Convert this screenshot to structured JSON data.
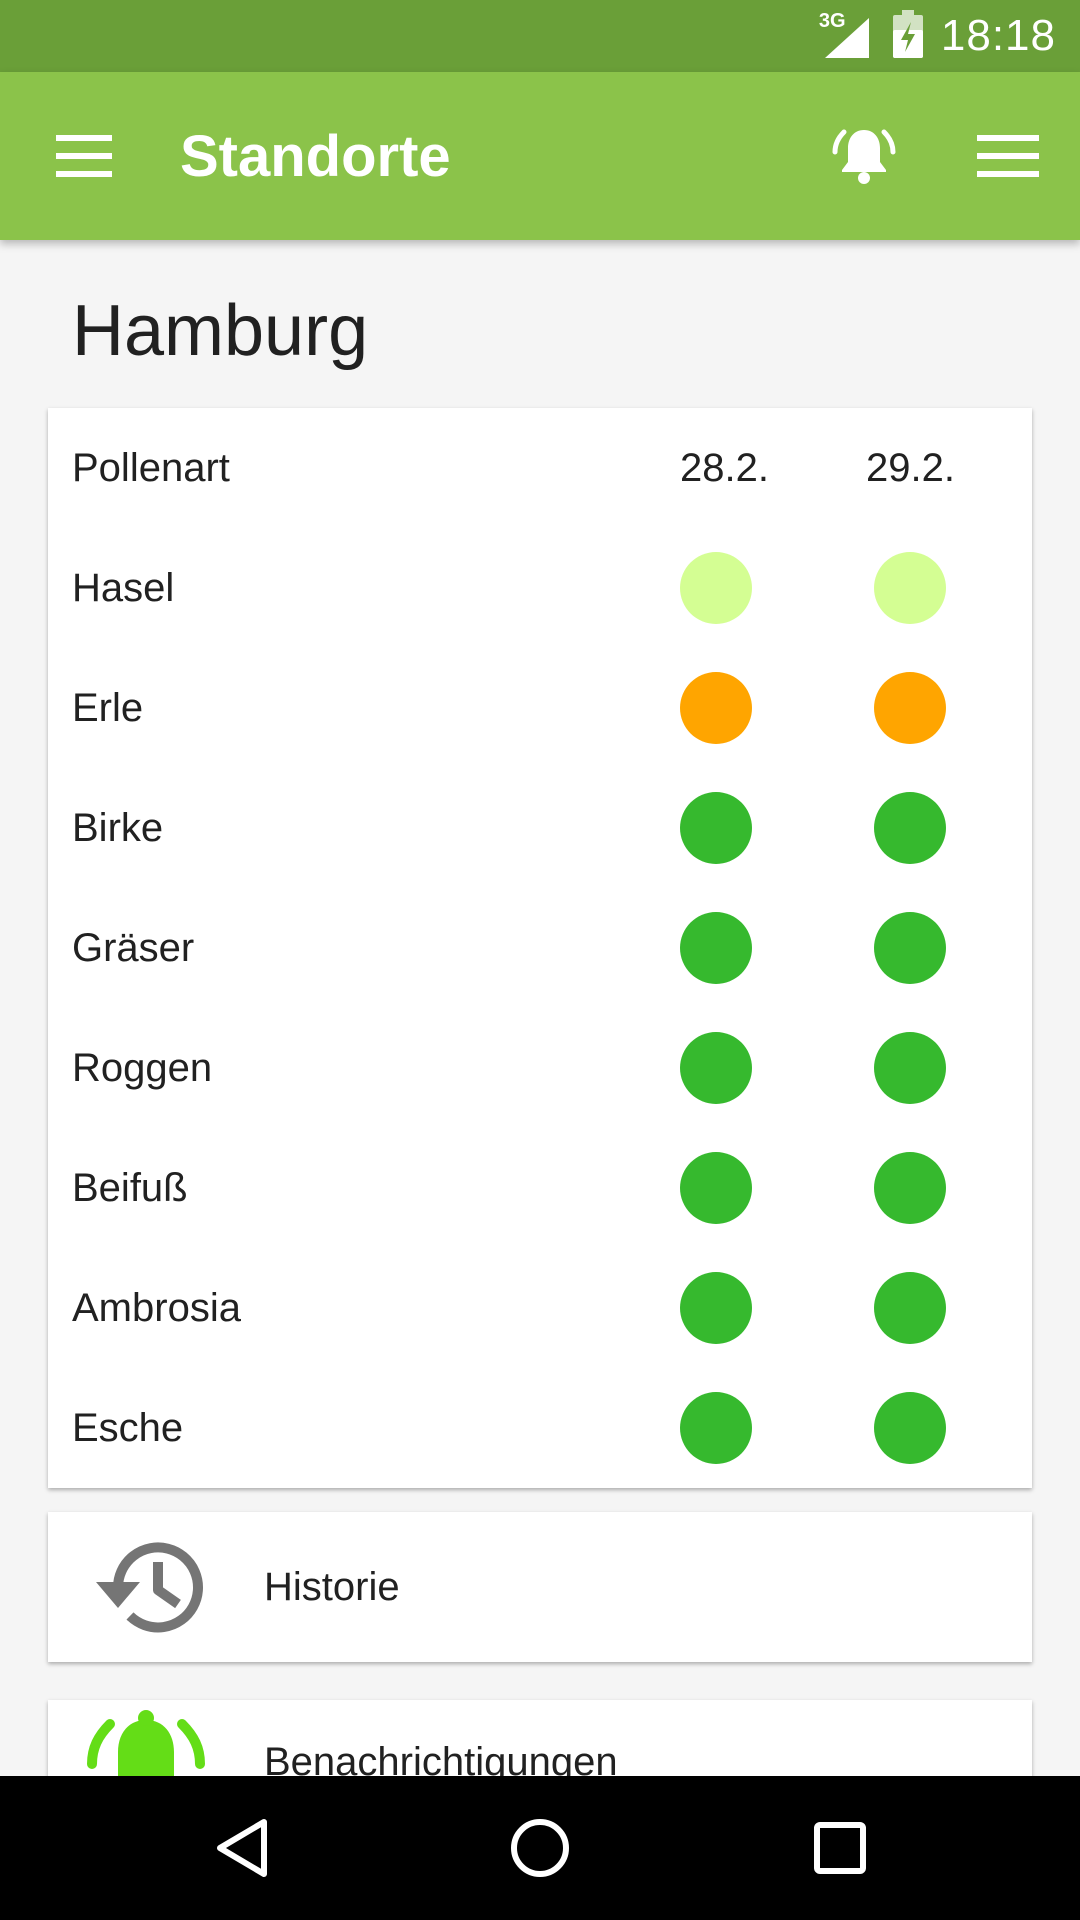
{
  "status_bar": {
    "network": "3G",
    "time": "18:18"
  },
  "app_bar": {
    "title": "Standorte"
  },
  "location": "Hamburg",
  "table": {
    "header": {
      "species": "Pollenart",
      "dates": [
        "28.2.",
        "29.2."
      ]
    },
    "rows": [
      {
        "name": "Hasel",
        "levels": [
          "light",
          "light"
        ]
      },
      {
        "name": "Erle",
        "levels": [
          "medium",
          "medium"
        ]
      },
      {
        "name": "Birke",
        "levels": [
          "none",
          "none"
        ]
      },
      {
        "name": "Gräser",
        "levels": [
          "none",
          "none"
        ]
      },
      {
        "name": "Roggen",
        "levels": [
          "none",
          "none"
        ]
      },
      {
        "name": "Beifuß",
        "levels": [
          "none",
          "none"
        ]
      },
      {
        "name": "Ambrosia",
        "levels": [
          "none",
          "none"
        ]
      },
      {
        "name": "Esche",
        "levels": [
          "none",
          "none"
        ]
      }
    ]
  },
  "level_colors": {
    "light": "#d4fe93",
    "medium": "#ffa500",
    "none": "#36b92e"
  },
  "history": {
    "label": "Historie",
    "icon": "history-icon"
  },
  "notifications": {
    "label": "Benachrichtigungen",
    "icon": "bell-alert-icon"
  },
  "colors": {
    "status_bar": "#6a9f38",
    "app_bar": "#8bc34a",
    "bell_green": "#64dd17"
  }
}
